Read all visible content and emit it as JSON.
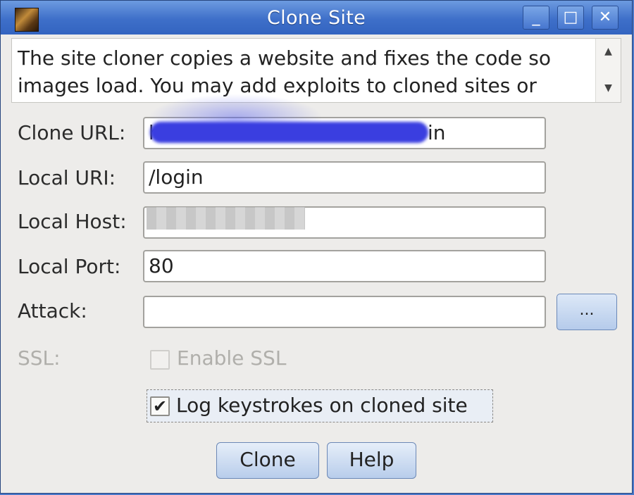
{
  "window": {
    "title": "Clone Site",
    "controls": {
      "minimize": "_",
      "maximize": "□",
      "close": "✕"
    }
  },
  "description": {
    "line1": "The site cloner copies a website and fixes the code so",
    "line2": "images load. You may add exploits to cloned sites or"
  },
  "form": {
    "clone_url": {
      "label": "Clone URL:",
      "value": "h",
      "value_tail": "in"
    },
    "local_uri": {
      "label": "Local URI:",
      "value": "/login"
    },
    "local_host": {
      "label": "Local Host:",
      "value": ""
    },
    "local_port": {
      "label": "Local Port:",
      "value": "80"
    },
    "attack": {
      "label": "Attack:",
      "value": "",
      "browse_label": "..."
    },
    "ssl": {
      "label": "SSL:",
      "checkbox_label": "Enable SSL",
      "checked": false,
      "enabled": false
    },
    "log_keystrokes": {
      "checkbox_label": "Log keystrokes on cloned site",
      "checked": true
    }
  },
  "buttons": {
    "clone": "Clone",
    "help": "Help"
  },
  "colors": {
    "titlebar": "#3e6fc9",
    "redaction": "#3a3ee0"
  }
}
